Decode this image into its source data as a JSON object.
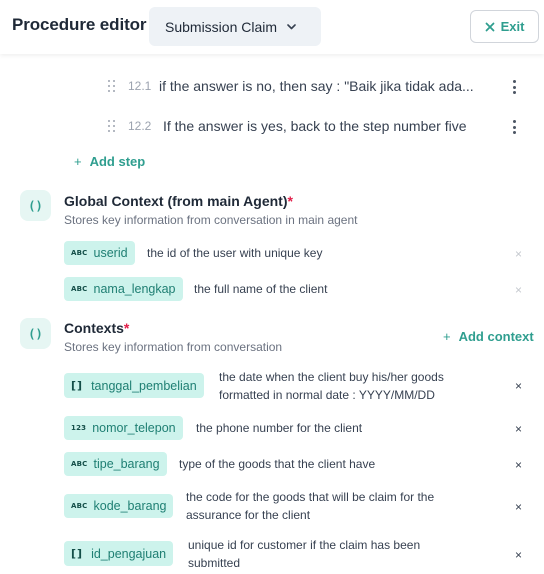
{
  "header": {
    "title": "Procedure editor",
    "procedure_selected": "Submission Claim",
    "exit_label": "Exit"
  },
  "steps": [
    {
      "number": "12.1",
      "text": "if the answer is no, then say : \"Baik jika tidak ada..."
    },
    {
      "number": "12.2",
      "text": "If the answer is yes, back to the step number five"
    }
  ],
  "add_step_label": "Add step",
  "global_context": {
    "icon_label": "()",
    "title": "Global Context (from main Agent)",
    "required_mark": "*",
    "subtitle": "Stores key information from conversation in main agent",
    "variables": [
      {
        "type_label": "ABC",
        "name": "userid",
        "description": "the id of the user with unique key"
      },
      {
        "type_label": "ABC",
        "name": "nama_lengkap",
        "description": "the full name of the client"
      }
    ]
  },
  "contexts": {
    "icon_label": "()",
    "title": "Contexts",
    "required_mark": "*",
    "subtitle": "Stores key information from conversation",
    "add_context_label": "Add context",
    "variables": [
      {
        "type_label": "[]",
        "name": "tanggal_pembelian",
        "description_line1": "the date when the client buy his/her goods",
        "description_line2": "formatted in normal date : YYYY/MM/DD"
      },
      {
        "type_label": "123",
        "name": "nomor_telepon",
        "description_line1": "the phone number for the client",
        "description_line2": ""
      },
      {
        "type_label": "ABC",
        "name": "tipe_barang",
        "description_line1": "type of the goods that the client have",
        "description_line2": ""
      },
      {
        "type_label": "ABC",
        "name": "kode_barang",
        "description_line1": "the code for the goods that will be claim for the",
        "description_line2": "assurance for the client"
      },
      {
        "type_label": "[]",
        "name": "id_pengajuan",
        "description_line1": "unique id for customer if the claim has been",
        "description_line2": "submitted"
      }
    ]
  },
  "icons": {
    "exit": "close-icon",
    "select": "chevron-down-icon",
    "drag": "drag-handle-icon",
    "menu": "kebab-menu-icon",
    "add": "plus-icon",
    "remove": "close-icon"
  },
  "colors": {
    "accent": "#2f9e8f",
    "chip_bg": "#cdf3ec",
    "required": "#e11d48"
  }
}
